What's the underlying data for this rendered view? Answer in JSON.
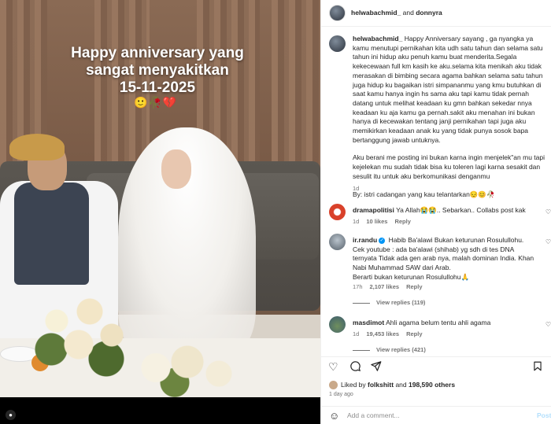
{
  "photo": {
    "overlay_line1": "Happy anniversary yang",
    "overlay_line2": "sangat menyakitkan",
    "overlay_date": "15-11-2025",
    "overlay_emoji": "🙂🥀💔"
  },
  "header": {
    "username": "helwabachmid_",
    "and_text": " and ",
    "collaborator": "donnyra"
  },
  "caption": {
    "username": "helwabachmid_",
    "paragraph1": "Happy Anniversary sayang , ga nyangka ya kamu menutupi pernikahan kita udh satu tahun dan selama satu tahun ini hidup aku penuh kamu buat menderita.Segala kekecewaan full km kasih ke aku.selama kita menikah aku tidak merasakan di bimbing secara agama bahkan selama satu tahun juga hidup ku bagaikan istri simpananmu yang kmu butuhkan di saat kamu hanya ingin hs sama aku tapi kamu tidak pernah datang untuk melihat keadaan ku gmn bahkan sekedar nnya keadaan ku aja kamu ga pernah.sakit aku menahan ini bukan hanya di kecewakan tentang janji pernikahan tapi juga aku memikirkan keadaan anak ku yang tidak punya sosok bapa bertanggung jawab untuknya.",
    "paragraph2": "Aku berani me posting ini bukan karna ingin menjelek\"an mu tapi kejelekan mu sudah tidak bisa ku toleren lagi karna sesakit dan sesulit itu untuk aku berkomunikasi denganmu",
    "paragraph3": "By: istri cadangan yang kau telantarkan😔😊🥀",
    "time": "1d"
  },
  "comments": [
    {
      "username": "dramapolitisi",
      "text": "Ya Allah😭😭.. Sebarkan.. Collabs post kak",
      "time": "1d",
      "likes": "10 likes",
      "reply": "Reply"
    },
    {
      "username": "ir.randu",
      "verified": "✓",
      "text": "Habib Ba'alawi Bukan keturunan Rosulullohu.\nCek youtube : ada ba'alawi (shihab) yg sdh di tes DNA ternyata Tidak ada gen arab nya, malah dominan India. Khan Nabi Muhammad SAW dari Arab.\nBerarti bukan keturunan Rosulullohu🙏",
      "time": "17h",
      "likes": "2,107 likes",
      "reply": "Reply",
      "view_replies": "View replies (119)"
    },
    {
      "username": "masdimot",
      "text": "Ahli agama belum tentu ahli agama",
      "time": "1d",
      "likes": "19,453 likes",
      "reply": "Reply",
      "view_replies": "View replies (421)"
    }
  ],
  "actions": {
    "liked_by_prefix": "Liked by ",
    "liked_by_user": "folkshitt",
    "and_text": " and ",
    "others": "198,590 others",
    "post_time": "1 day ago"
  },
  "comment_box": {
    "placeholder": "Add a comment...",
    "post_label": "Post"
  },
  "icons": {
    "heart": "heart-icon",
    "comment": "comment-icon",
    "share": "share-icon",
    "save": "bookmark-icon",
    "emoji": "emoji-icon"
  },
  "colors": {
    "link_blue": "#0095f6",
    "post_disabled": "#b2dffc",
    "muted_text": "#737373"
  }
}
